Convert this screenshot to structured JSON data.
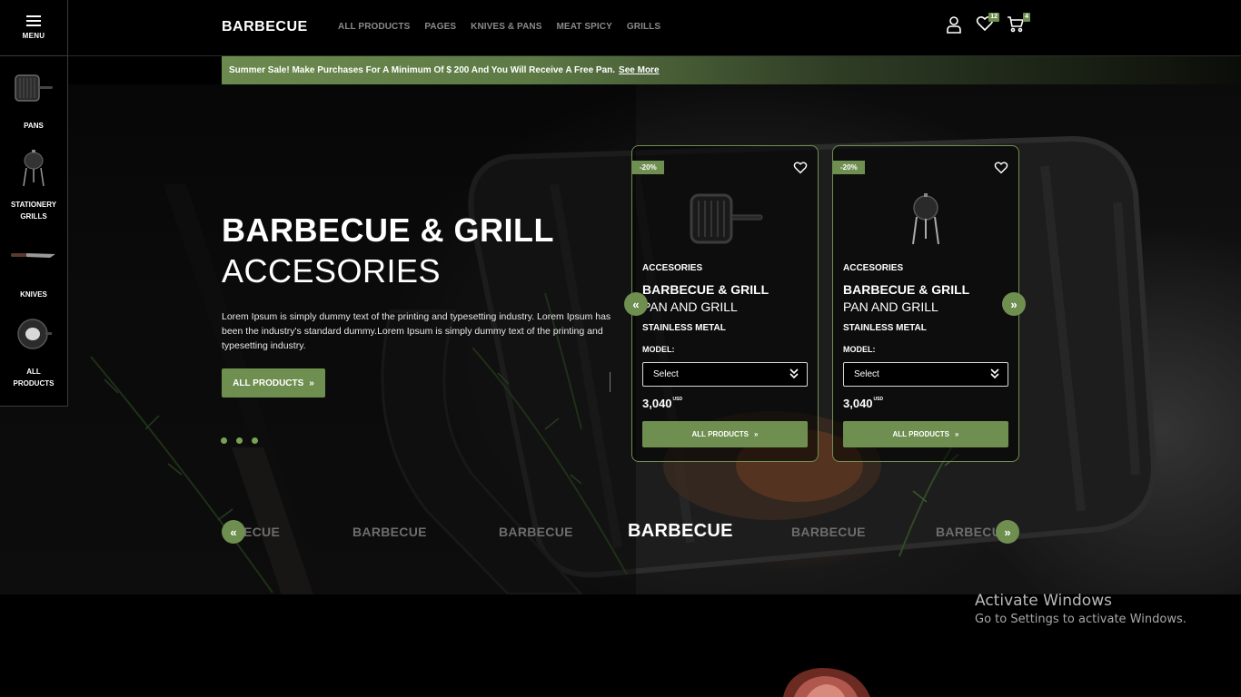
{
  "sidebar": {
    "menu_label": "MENU",
    "items": [
      {
        "label": "PANS",
        "icon": "grill-pan-icon"
      },
      {
        "label": "STATIONERY\nGRILLS",
        "label1": "STATIONERY",
        "label2": "GRILLS",
        "icon": "kettle-grill-icon"
      },
      {
        "label": "KNIVES",
        "icon": "knife-icon"
      },
      {
        "label1": "ALL",
        "label2": "PRODUCTS",
        "icon": "round-pan-icon"
      }
    ]
  },
  "header": {
    "brand": "BARBECUE",
    "nav": [
      "ALL PRODUCTS",
      "PAGES",
      "KNIVES & PANS",
      "MEAT SPICY",
      "GRILLS"
    ],
    "wishlist_count": "12",
    "cart_count": "4"
  },
  "promo": {
    "text": "Summer Sale! Make Purchases For A Minimum Of $ 200 And You Will Receive A Free Pan.",
    "link": "See More"
  },
  "hero": {
    "title_bold": "BARBECUE & GRILL",
    "title_light": "ACCESORIES",
    "description": "Lorem Ipsum is simply dummy text of the printing and typesetting industry. Lorem Ipsum has been the industry's standard dummy.Lorem Ipsum is simply dummy text of the printing and typesetting industry.",
    "button": "ALL PRODUCTS"
  },
  "products": [
    {
      "discount": "-20%",
      "category": "ACCESORIES",
      "name_bold": "BARBECUE & GRILL",
      "name_light": "PAN AND GRILL",
      "material": "STAINLESS METAL",
      "model_label": "MODEL:",
      "select": "Select",
      "price": "3,040",
      "currency": "USD",
      "button": "ALL PRODUCTS",
      "image": "grill-pan"
    },
    {
      "discount": "-20%",
      "category": "ACCESORIES",
      "name_bold": "BARBECUE & GRILL",
      "name_light": "PAN AND GRILL",
      "material": "STAINLESS METAL",
      "model_label": "MODEL:",
      "select": "Select",
      "price": "3,040",
      "currency": "USD",
      "button": "ALL PRODUCTS",
      "image": "kettle-grill"
    }
  ],
  "brand_strip": [
    "ECUE",
    "BARBECUE",
    "BARBECUE",
    "BARBECUE",
    "BARBECUE",
    "BARBECUE"
  ],
  "windows_watermark": {
    "title": "Activate Windows",
    "subtitle": "Go to Settings to activate Windows."
  },
  "colors": {
    "accent": "#6f8f50",
    "background": "#000000"
  }
}
